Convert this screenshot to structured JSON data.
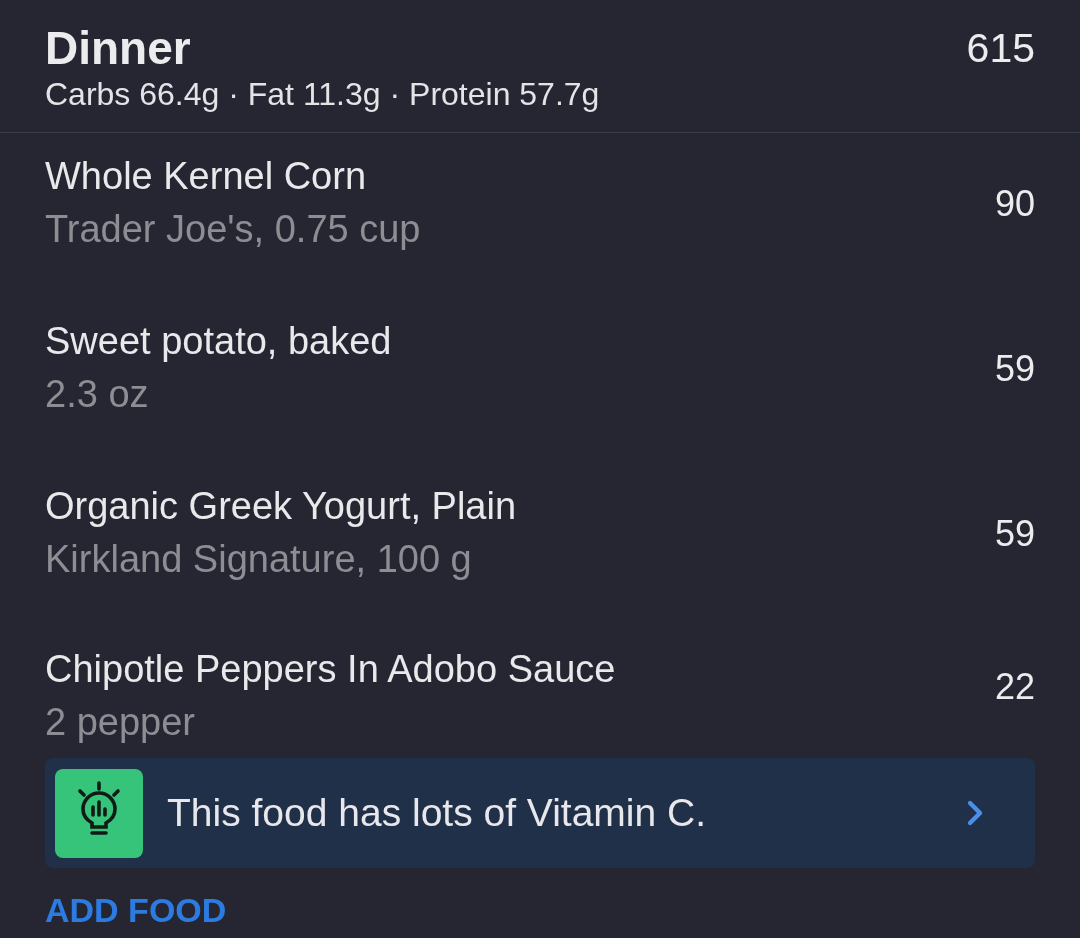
{
  "meal": {
    "title": "Dinner",
    "calories": "615",
    "macros": "Carbs 66.4g · Fat 11.3g · Protein 57.7g"
  },
  "foods": [
    {
      "name": "Whole Kernel Corn",
      "serving": "Trader Joe's, 0.75 cup",
      "calories": "90"
    },
    {
      "name": "Sweet potato, baked",
      "serving": "2.3 oz",
      "calories": "59"
    },
    {
      "name": "Organic Greek Yogurt, Plain",
      "serving": "Kirkland Signature, 100 g",
      "calories": "59"
    },
    {
      "name": "Chipotle Peppers In Adobo Sauce",
      "serving": "2 pepper",
      "calories": "22"
    }
  ],
  "tip": {
    "text": "This food has lots of Vitamin C."
  },
  "add_food_button": {
    "label": "ADD FOOD"
  }
}
